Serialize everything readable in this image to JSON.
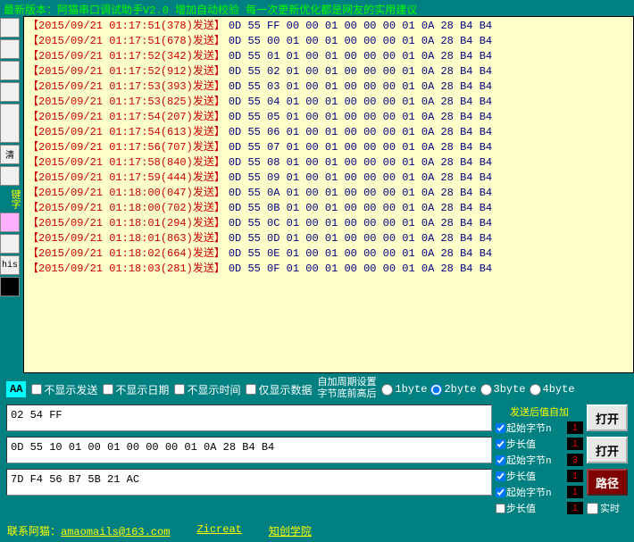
{
  "topbar": "最新版本：阿猫串口调试助手V2.0 增加自动校验 每一次更新优化都是网友的实用建议",
  "leftcol": {
    "btn_clear": "清",
    "label_key": "键字",
    "btn_his": "his"
  },
  "log": [
    {
      "ts": "【2015/09/21 01:17:51(378)发送】",
      "hex": "0D 55 FF 00 00 01 00 00 00 01 0A 28 B4 B4"
    },
    {
      "ts": "【2015/09/21 01:17:51(678)发送】",
      "hex": "0D 55 00 01 00 01 00 00 00 01 0A 28 B4 B4"
    },
    {
      "ts": "【2015/09/21 01:17:52(342)发送】",
      "hex": "0D 55 01 01 00 01 00 00 00 01 0A 28 B4 B4"
    },
    {
      "ts": "【2015/09/21 01:17:52(912)发送】",
      "hex": "0D 55 02 01 00 01 00 00 00 01 0A 28 B4 B4"
    },
    {
      "ts": "【2015/09/21 01:17:53(393)发送】",
      "hex": "0D 55 03 01 00 01 00 00 00 01 0A 28 B4 B4"
    },
    {
      "ts": "【2015/09/21 01:17:53(825)发送】",
      "hex": "0D 55 04 01 00 01 00 00 00 01 0A 28 B4 B4"
    },
    {
      "ts": "【2015/09/21 01:17:54(207)发送】",
      "hex": "0D 55 05 01 00 01 00 00 00 01 0A 28 B4 B4"
    },
    {
      "ts": "【2015/09/21 01:17:54(613)发送】",
      "hex": "0D 55 06 01 00 01 00 00 00 01 0A 28 B4 B4"
    },
    {
      "ts": "【2015/09/21 01:17:56(707)发送】",
      "hex": "0D 55 07 01 00 01 00 00 00 01 0A 28 B4 B4"
    },
    {
      "ts": "【2015/09/21 01:17:58(840)发送】",
      "hex": "0D 55 08 01 00 01 00 00 00 01 0A 28 B4 B4"
    },
    {
      "ts": "【2015/09/21 01:17:59(444)发送】",
      "hex": "0D 55 09 01 00 01 00 00 00 01 0A 28 B4 B4"
    },
    {
      "ts": "【2015/09/21 01:18:00(047)发送】",
      "hex": "0D 55 0A 01 00 01 00 00 00 01 0A 28 B4 B4"
    },
    {
      "ts": "【2015/09/21 01:18:00(702)发送】",
      "hex": "0D 55 0B 01 00 01 00 00 00 01 0A 28 B4 B4"
    },
    {
      "ts": "【2015/09/21 01:18:01(294)发送】",
      "hex": "0D 55 0C 01 00 01 00 00 00 01 0A 28 B4 B4"
    },
    {
      "ts": "【2015/09/21 01:18:01(863)发送】",
      "hex": "0D 55 0D 01 00 01 00 00 00 01 0A 28 B4 B4"
    },
    {
      "ts": "【2015/09/21 01:18:02(664)发送】",
      "hex": "0D 55 0E 01 00 01 00 00 00 01 0A 28 B4 B4"
    },
    {
      "ts": "【2015/09/21 01:18:03(281)发送】",
      "hex": "0D 55 0F 01 00 01 00 00 00 01 0A 28 B4 B4"
    }
  ],
  "checks": {
    "aa": "AA",
    "noshow_send": "不显示发送",
    "noshow_date": "不显示日期",
    "noshow_time": "不显示时间",
    "only_data": "仅显示数据",
    "period_label1": "自加周期设置",
    "period_label2": "字节底前高后",
    "r1": "1byte",
    "r2": "2byte",
    "r3": "3byte",
    "r4": "4byte"
  },
  "inputs": {
    "f1": "02 54 FF",
    "f2": "0D 55 10 01 00 01 00 00 00 01 0A 28 B4 B4",
    "f3": "7D F4 56 B7 5B 21 AC"
  },
  "side": {
    "title": "发送后值自加",
    "startbyte": "起始字节n",
    "step": "步长值",
    "v1": "1",
    "v2": "1",
    "v3": "3",
    "v4": "1",
    "v5": "1",
    "v6": "1"
  },
  "btns": {
    "open": "打开",
    "path": "路径",
    "realtime": "实时"
  },
  "footer": {
    "contact_label": "联系阿猫：",
    "email": "amaomails@163.com",
    "zicreat": "Zicreat",
    "college": "知创学院"
  }
}
